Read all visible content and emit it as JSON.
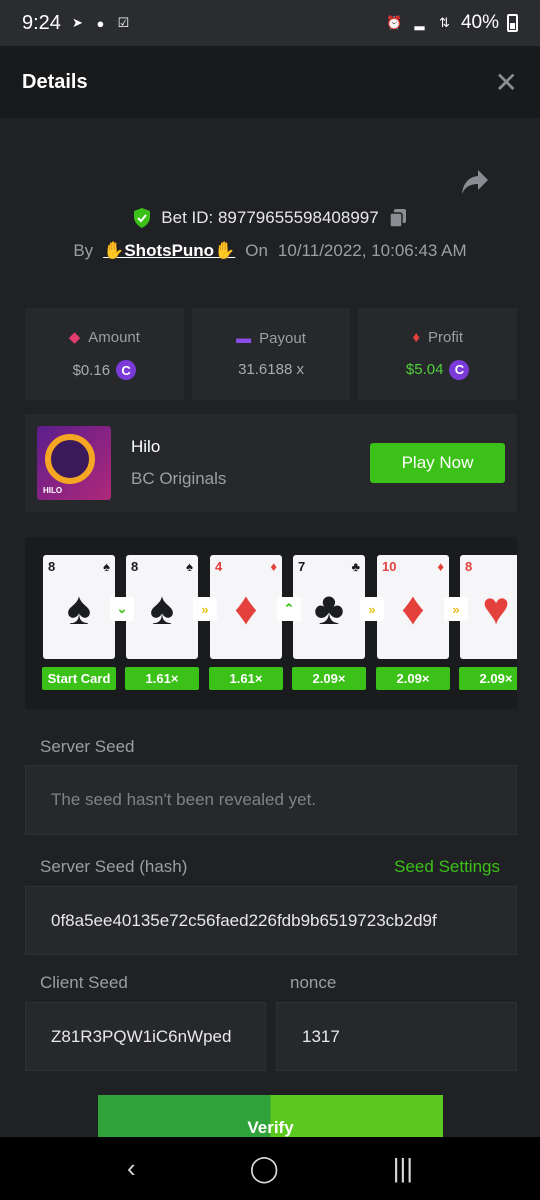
{
  "status": {
    "time": "9:24",
    "battery": "40%"
  },
  "header": {
    "title": "Details",
    "close": "✕"
  },
  "bet": {
    "id_label": "Bet ID: 89779655598408997",
    "by": "By",
    "user": "ShotsPuno",
    "on": "On",
    "date": "10/11/2022, 10:06:43 AM"
  },
  "stats": {
    "amount_label": "Amount",
    "amount_value": "$0.16",
    "payout_label": "Payout",
    "payout_value": "31.6188 x",
    "profit_label": "Profit",
    "profit_value": "$5.04",
    "coin": "C"
  },
  "game": {
    "name": "Hilo",
    "category": "BC Originals",
    "thumb_label": "HILO",
    "play_label": "Play Now"
  },
  "hilo": {
    "cards": [
      {
        "rank": "8",
        "suit": "♠",
        "color": "black"
      },
      {
        "rank": "8",
        "suit": "♠",
        "color": "black"
      },
      {
        "rank": "4",
        "suit": "♦",
        "color": "red"
      },
      {
        "rank": "7",
        "suit": "♣",
        "color": "black"
      },
      {
        "rank": "10",
        "suit": "♦",
        "color": "red"
      },
      {
        "rank": "8",
        "suit": "♥",
        "color": "red"
      }
    ],
    "arrows": [
      "⌄",
      "»",
      "⌃",
      "»",
      "»"
    ],
    "multipliers": [
      "Start Card",
      "1.61×",
      "1.61×",
      "2.09×",
      "2.09×",
      "2.09×"
    ]
  },
  "seeds": {
    "server_seed_label": "Server Seed",
    "server_seed_value": "The seed hasn't been revealed yet.",
    "hash_label": "Server Seed (hash)",
    "seed_settings": "Seed Settings",
    "hash_value": "0f8a5ee40135e72c56faed226fdb9b6519723cb2d9f",
    "client_seed_label": "Client Seed",
    "client_seed_value": "Z81R3PQW1iC6nWped",
    "nonce_label": "nonce",
    "nonce_value": "1317"
  },
  "verify_label": "Verify",
  "nav": {
    "back": "‹",
    "home": "◯",
    "recents": "|||"
  }
}
